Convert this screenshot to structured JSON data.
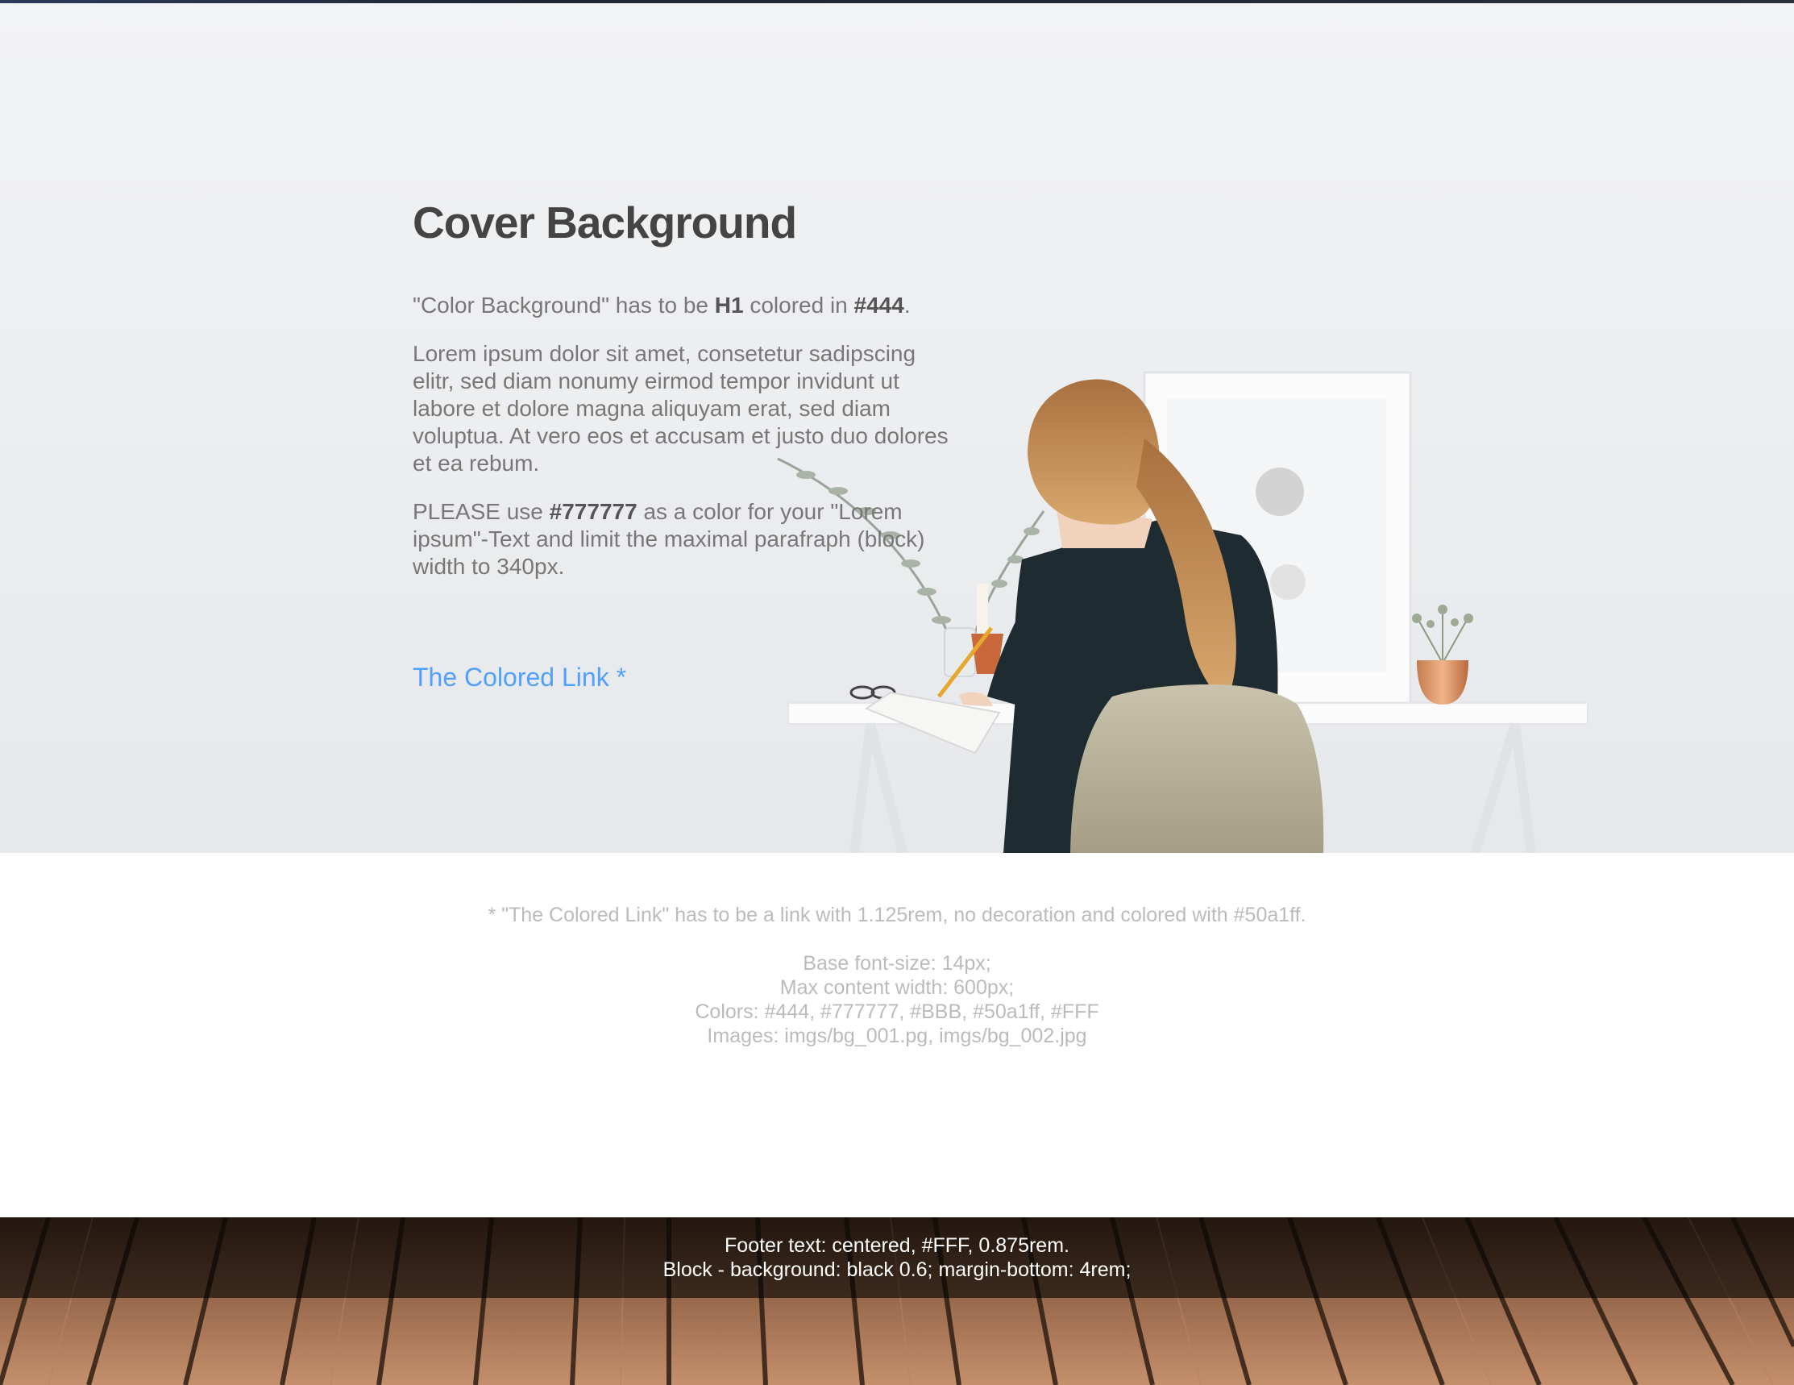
{
  "cover": {
    "title": "Cover Background",
    "p1": {
      "pre": "\"Color Background\" has to be ",
      "b1": "H1",
      "mid": " colored in ",
      "b2": "#444",
      "post": "."
    },
    "p2": "Lorem ipsum dolor sit amet, consetetur sadipscing elitr, sed diam nonumy eirmod tempor invidunt ut labore et dolore magna aliquyam erat, sed diam voluptua. At vero eos et accusam et justo duo dolores et ea rebum.",
    "p3": {
      "pre": "PLEASE use ",
      "b1": "#777777",
      "post": " as a color for your \"Lorem ipsum\"-Text and limit the maximal parafraph (block) width to 340px."
    },
    "link_label": "The Colored Link *"
  },
  "notes": {
    "line1": "* \"The Colored Link\" has to be a link with 1.125rem, no decoration and colored with #50a1ff.",
    "line2": "Base font-size: 14px;",
    "line3": "Max content width: 600px;",
    "line4": "Colors: #444, #777777, #BBB, #50a1ff, #FFF",
    "line5": "Images: imgs/bg_001.pg, imgs/bg_002.jpg"
  },
  "footer": {
    "line1": "Footer text: centered, #FFF, 0.875rem.",
    "line2": "Block - background: black 0.6; margin-bottom: 4rem;"
  },
  "colors": {
    "heading": "#444444",
    "text": "#777777",
    "link": "#50a1ff",
    "note": "#bbbbbb",
    "footer_text": "#ffffff"
  },
  "images": {
    "cover": "woman-at-desk-photo",
    "footer": "wooden-floor-photo"
  }
}
